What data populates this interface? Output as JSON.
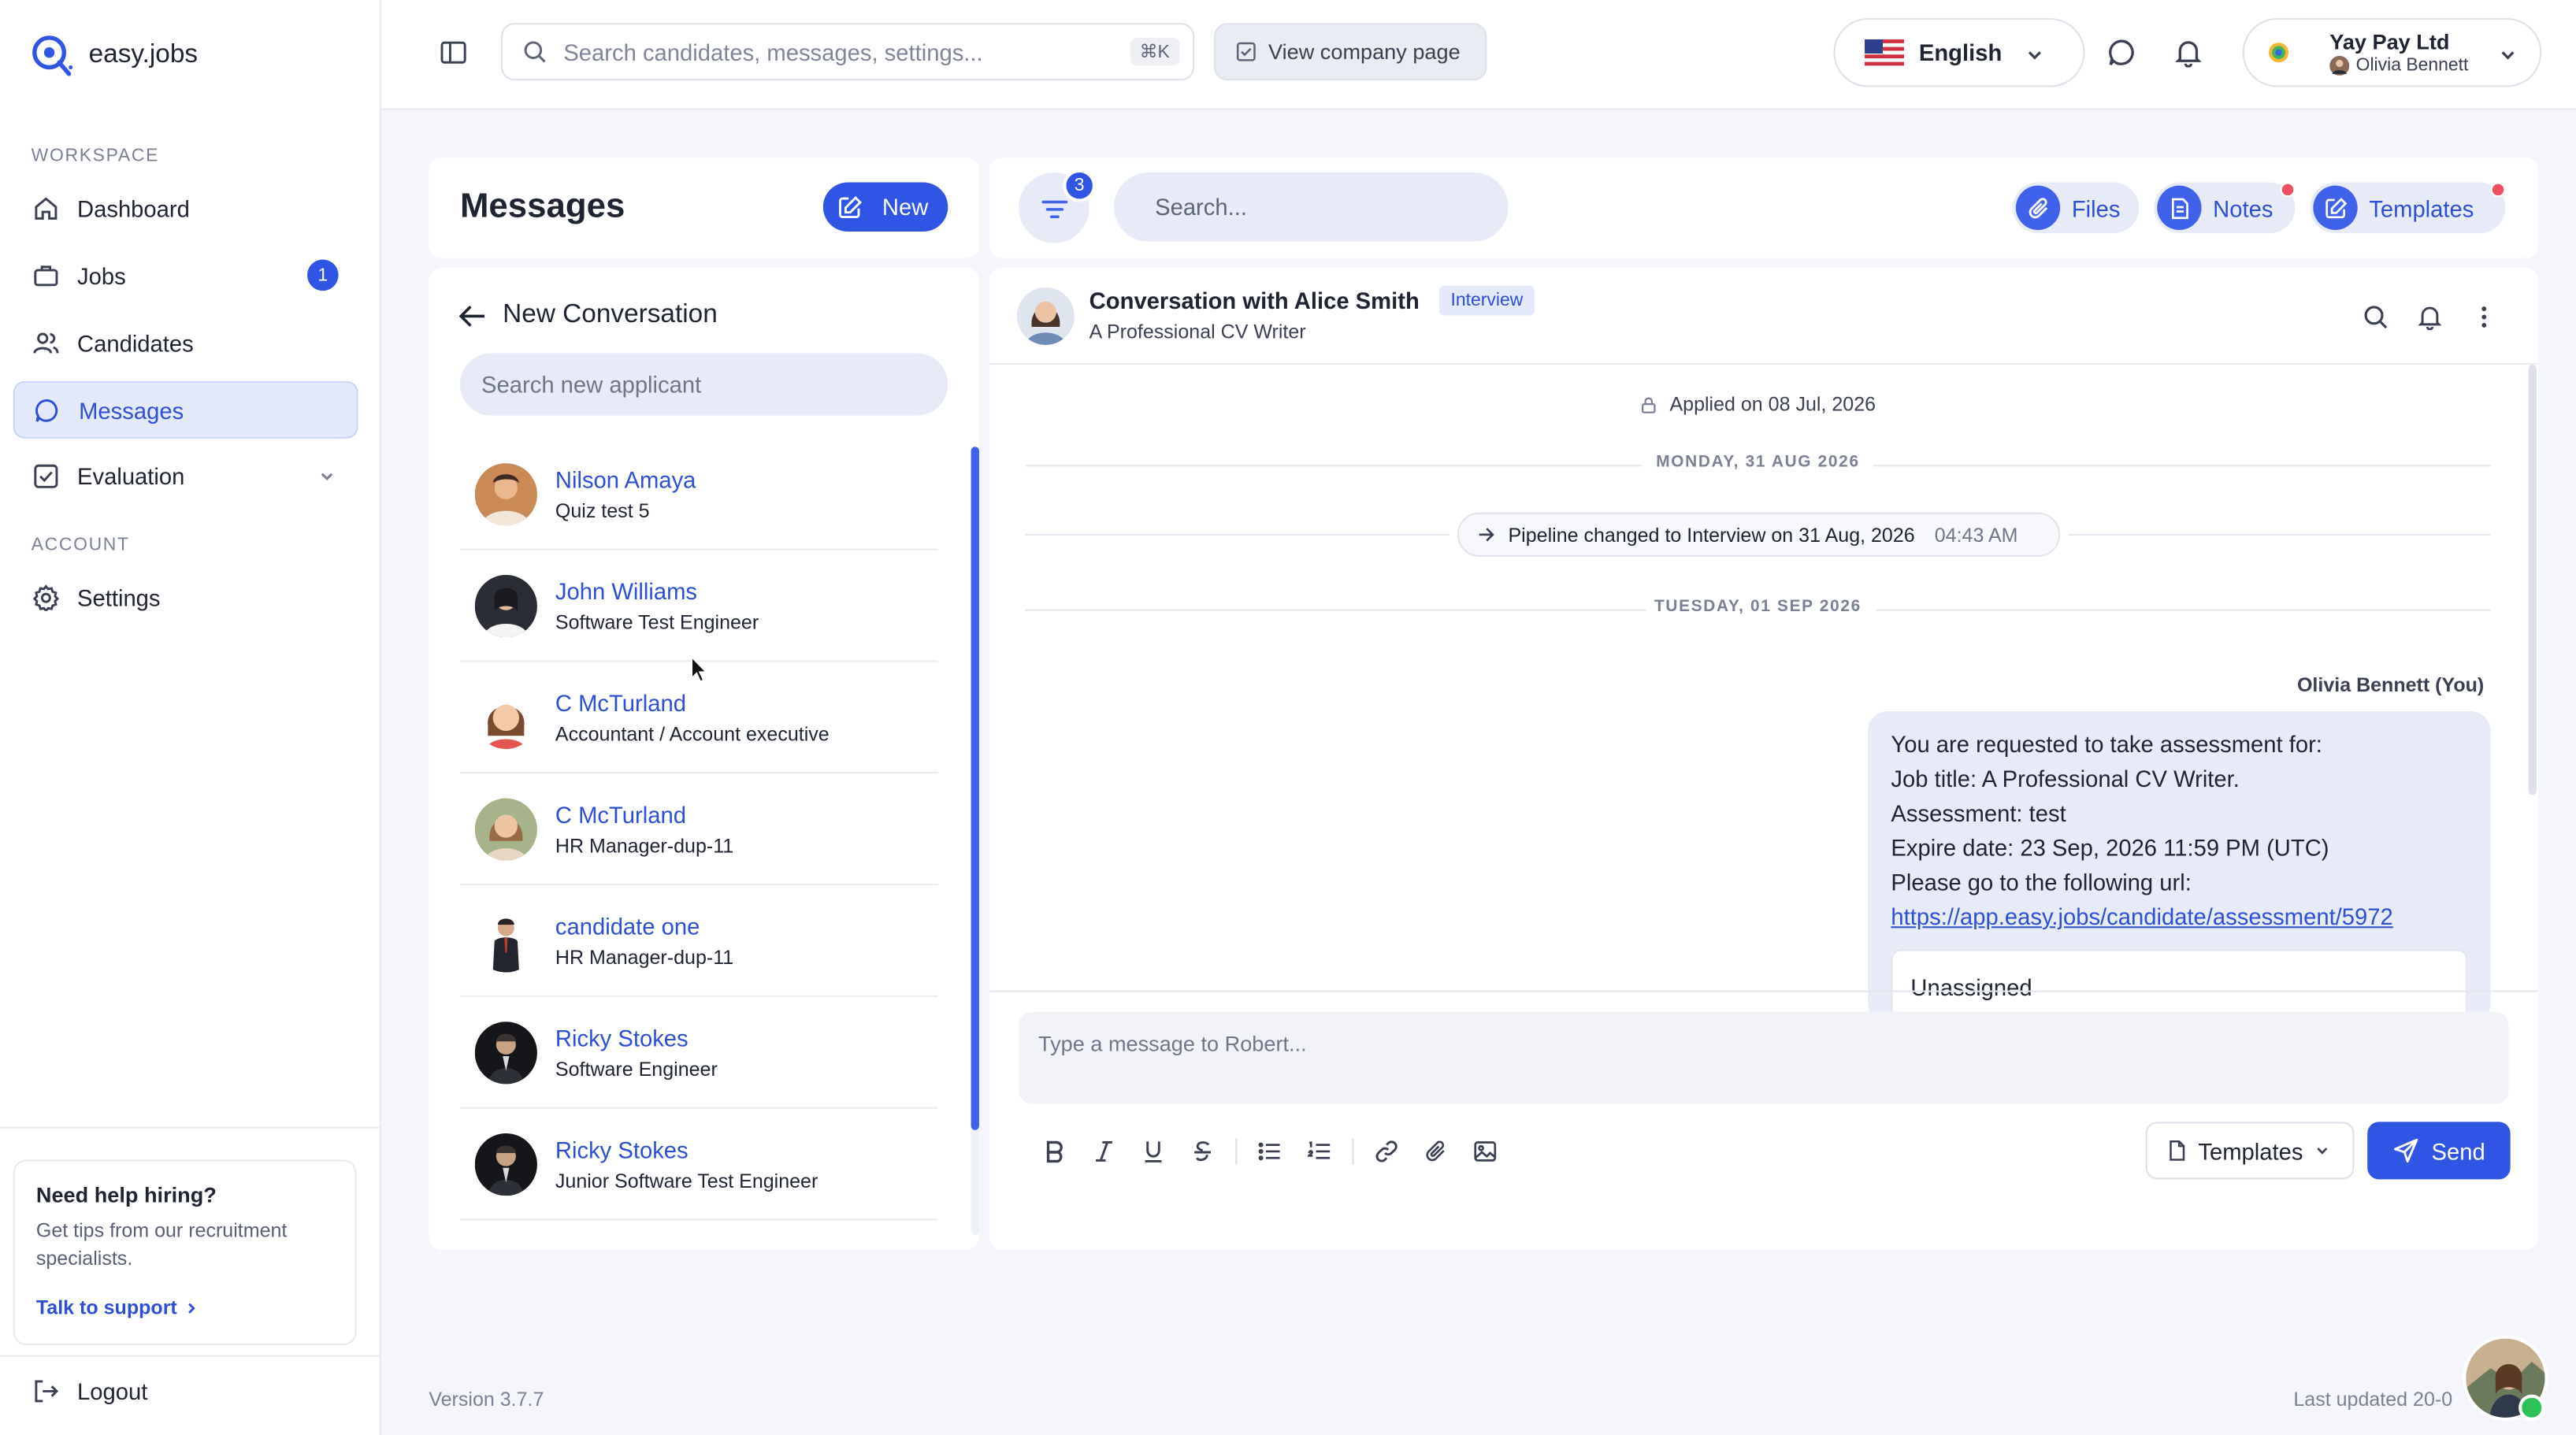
{
  "app": {
    "logo_text": "easy.jobs"
  },
  "sidebar": {
    "workspace_label": "WORKSPACE",
    "account_label": "ACCOUNT",
    "items": [
      {
        "label": "Dashboard",
        "icon": "home-icon"
      },
      {
        "label": "Jobs",
        "icon": "briefcase-icon",
        "badge": "1"
      },
      {
        "label": "Candidates",
        "icon": "users-icon"
      },
      {
        "label": "Messages",
        "icon": "chat-icon",
        "active": true
      },
      {
        "label": "Evaluation",
        "icon": "checkbox-icon"
      }
    ],
    "settings_label": "Settings",
    "help": {
      "title": "Need help hiring?",
      "text": "Get tips from our recruitment specialists.",
      "link": "Talk to support"
    },
    "logout_label": "Logout"
  },
  "topbar": {
    "search_placeholder": "Search candidates, messages, settings...",
    "shortcut": "⌘K",
    "company_button": "View company page",
    "language": "English",
    "company_name": "Yay Pay Ltd",
    "user_name": "Olivia Bennett"
  },
  "messages": {
    "title": "Messages",
    "new_button": "New",
    "new_conversation": "New Conversation",
    "applicant_search_placeholder": "Search new applicant",
    "candidates": [
      {
        "name": "Nilson Amaya",
        "role": "Quiz test 5"
      },
      {
        "name": "John Williams",
        "role": "Software Test Engineer"
      },
      {
        "name": "C McTurland",
        "role": "Accountant / Account executive"
      },
      {
        "name": "C McTurland",
        "role": "HR Manager-dup-11"
      },
      {
        "name": "candidate one",
        "role": "HR Manager-dup-11"
      },
      {
        "name": "Ricky Stokes",
        "role": "Software Engineer"
      },
      {
        "name": "Ricky Stokes",
        "role": "Junior Software Test Engineer"
      }
    ]
  },
  "toolbar": {
    "filter_count": "3",
    "search_placeholder": "Search...",
    "files": "Files",
    "notes": "Notes",
    "templates": "Templates"
  },
  "conversation": {
    "title": "Conversation with Alice Smith",
    "stage_badge": "Interview",
    "subtitle": "A Professional CV Writer",
    "applied": "Applied on 08 Jul, 2026",
    "day1": "MONDAY, 31 AUG 2026",
    "pipeline_text": "Pipeline changed to Interview on 31 Aug, 2026",
    "pipeline_time": "04:43 AM",
    "day2": "TUESDAY, 01 SEP 2026",
    "sender": "Olivia Bennett (You)",
    "message_lines": [
      "You are requested to take assessment for:",
      "Job title: A Professional CV Writer.",
      "Assessment: test",
      "Expire date: 23 Sep, 2026 11:59 PM (UTC)",
      "Please go to the following url:"
    ],
    "message_link": "https://app.easy.jobs/candidate/assessment/5972",
    "inner_card": "Unassigned",
    "compose_placeholder": "Type a message to Robert...",
    "templates_button": "Templates",
    "send_button": "Send"
  },
  "footer": {
    "version": "Version 3.7.7",
    "last_updated": "Last updated 20-0"
  },
  "colors": {
    "accent": "#2f55e4",
    "active_bg": "#e3e9fb",
    "pill_bg": "#e6ebf7",
    "alert": "#f04f5f",
    "online": "#2ec256"
  }
}
